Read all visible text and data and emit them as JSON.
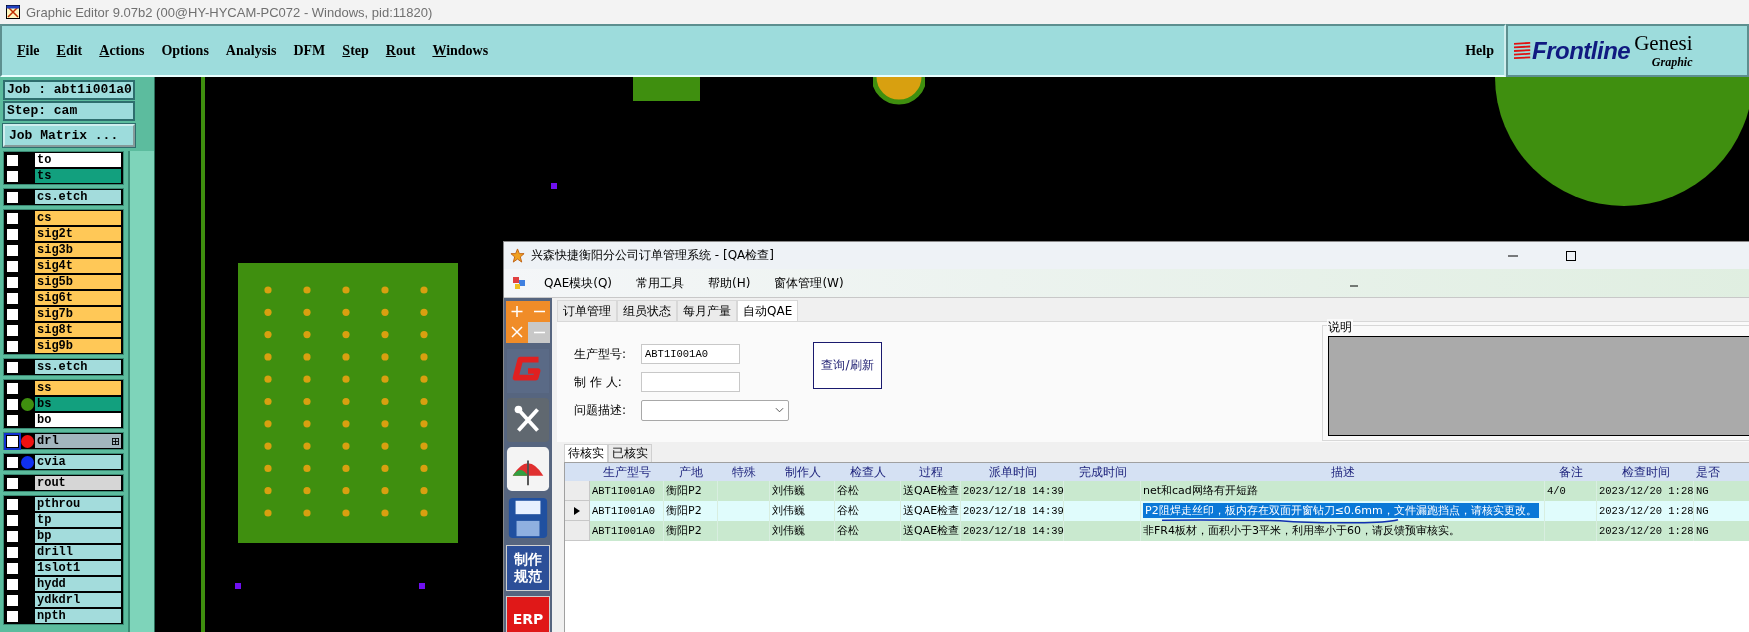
{
  "window": {
    "title": "Graphic Editor 9.07b2 (00@HY-HYCAM-PC072 - Windows, pid:11820)"
  },
  "menu_bar": {
    "items": [
      {
        "label": "File",
        "underlined": true
      },
      {
        "label": "Edit",
        "underlined": true
      },
      {
        "label": "Actions",
        "underlined": true
      },
      {
        "label": "Options",
        "underlined": false
      },
      {
        "label": "Analysis",
        "underlined": false
      },
      {
        "label": "DFM",
        "underlined": false
      },
      {
        "label": "Step",
        "underlined": true
      },
      {
        "label": "Rout",
        "underlined": true
      },
      {
        "label": "Windows",
        "underlined": true
      }
    ],
    "help": "Help"
  },
  "logo": {
    "brand": "Frontline",
    "product": "Genesi",
    "subtitle": "Graphic"
  },
  "job_panel": {
    "job": "Job : abt1i001a0",
    "step": "Step: cam",
    "matrix_button": "Job Matrix ..."
  },
  "layer_groups": [
    {
      "layers": [
        {
          "name": "to",
          "color": "#ffffff",
          "checked": false,
          "selected": false
        },
        {
          "name": "ts",
          "color": "#12a07e",
          "checked": false,
          "selected": false
        }
      ]
    },
    {
      "layers": [
        {
          "name": "cs.etch",
          "color": "#a3dcdc",
          "checked": false,
          "selected": false
        }
      ]
    },
    {
      "layers": [
        {
          "name": "cs",
          "color": "#ffc857",
          "checked": false,
          "selected": false
        },
        {
          "name": "sig2t",
          "color": "#ffc857",
          "checked": false,
          "selected": false
        },
        {
          "name": "sig3b",
          "color": "#ffc857",
          "checked": false,
          "selected": false
        },
        {
          "name": "sig4t",
          "color": "#ffc857",
          "checked": false,
          "selected": false
        },
        {
          "name": "sig5b",
          "color": "#ffc857",
          "checked": false,
          "selected": false
        },
        {
          "name": "sig6t",
          "color": "#ffc857",
          "checked": false,
          "selected": false
        },
        {
          "name": "sig7b",
          "color": "#ffc857",
          "checked": false,
          "selected": false
        },
        {
          "name": "sig8t",
          "color": "#ffc857",
          "checked": false,
          "selected": false
        },
        {
          "name": "sig9b",
          "color": "#ffc857",
          "checked": false,
          "selected": false
        }
      ]
    },
    {
      "layers": [
        {
          "name": "ss.etch",
          "color": "#a3dcdc",
          "checked": false,
          "selected": false
        }
      ]
    },
    {
      "layers": [
        {
          "name": "ss",
          "color": "#ffc857",
          "checked": false,
          "selected": false
        },
        {
          "name": "bs",
          "color": "#12a07e",
          "dot": {
            "color": "#3f8f0f"
          },
          "checked": false,
          "selected": false
        },
        {
          "name": "bo",
          "color": "#ffffff",
          "checked": false,
          "selected": false
        }
      ]
    },
    {
      "layers": [
        {
          "name": "drl",
          "color": "#a2b6be",
          "dot": {
            "color": "#f01010"
          },
          "checked": false,
          "selected": true
        }
      ]
    },
    {
      "layers": [
        {
          "name": "cvia",
          "color": "#a3dcdc",
          "dot": {
            "color": "#1030f0"
          },
          "checked": false,
          "selected": false
        }
      ]
    },
    {
      "layers": [
        {
          "name": "rout",
          "color": "#d6d6d6",
          "checked": false,
          "selected": false
        }
      ]
    },
    {
      "layers": [
        {
          "name": "pthrou",
          "color": "#a3dcdc",
          "checked": false,
          "selected": false
        },
        {
          "name": "tp",
          "color": "#a3dcdc",
          "checked": false,
          "selected": false
        },
        {
          "name": "bp",
          "color": "#a3dcdc",
          "checked": false,
          "selected": false
        },
        {
          "name": "drill",
          "color": "#a3dcdc",
          "checked": false,
          "selected": false
        },
        {
          "name": "1slot1",
          "color": "#a3dcdc",
          "checked": false,
          "selected": false
        },
        {
          "name": "hydd",
          "color": "#a3dcdc",
          "checked": false,
          "selected": false
        },
        {
          "name": "ydkdrl",
          "color": "#a3dcdc",
          "checked": false,
          "selected": false
        },
        {
          "name": "npth",
          "color": "#a3dcdc",
          "checked": false,
          "selected": false
        }
      ]
    }
  ],
  "dialog": {
    "title": "兴森快捷衡阳分公司订单管理系统 - [QA检查]",
    "menu": [
      "QAE模块(Q)",
      "常用工具",
      "帮助(H)",
      "窗体管理(W)"
    ],
    "toolbar": [
      {
        "kind": "calculator"
      },
      {
        "kind": "logo"
      },
      {
        "kind": "tools"
      },
      {
        "kind": "umbrella"
      },
      {
        "kind": "save"
      },
      {
        "kind": "text",
        "label": "制作规范",
        "color": "#2c4f98"
      },
      {
        "kind": "text",
        "label": "ERP",
        "color": "#e01818"
      }
    ],
    "tabs": [
      {
        "label": "订单管理",
        "selected": false
      },
      {
        "label": "组员状态",
        "selected": false
      },
      {
        "label": "每月产量",
        "selected": false
      },
      {
        "label": "自动QAE",
        "selected": true
      }
    ],
    "form": {
      "model_label": "生产型号:",
      "model_value": "ABT1I001A0",
      "maker_label": "制 作 人:",
      "issue_label": "问题描述:",
      "query_button": "查询/刷新"
    },
    "note_group": {
      "label": "说明"
    },
    "subtabs": [
      {
        "label": "待核实",
        "selected": true
      },
      {
        "label": "已核实",
        "selected": false
      }
    ],
    "table": {
      "columns": [
        "生产型号",
        "产地",
        "特殊",
        "制作人",
        "检查人",
        "过程",
        "派单时间",
        "完成时间",
        "描述",
        "备注",
        "检查时间",
        "是否"
      ],
      "rows": [
        {
          "model": "ABT1I001A0",
          "origin": "衡阳P2",
          "maker": "刘伟巍",
          "inspector": "谷松",
          "process": "送QAE检查",
          "dispatch_time": "2023/12/18 14:39",
          "description": "net和cad网络有开短路",
          "remark": "4/0",
          "check_time": "2023/12/20 1:28",
          "result": "NG",
          "selected": false
        },
        {
          "model": "ABT1I001A0",
          "origin": "衡阳P2",
          "maker": "刘伟巍",
          "inspector": "谷松",
          "process": "送QAE检查",
          "dispatch_time": "2023/12/18 14:39",
          "description": "P2阻焊走丝印，板内存在双面开窗钻刀≤0.6mm，文件漏跑挡点，请核实更改。",
          "check_time": "2023/12/20 1:28",
          "result": "NG",
          "selected": true
        },
        {
          "model": "ABT1I001A0",
          "origin": "衡阳P2",
          "maker": "刘伟巍",
          "inspector": "谷松",
          "process": "送QAE检查",
          "dispatch_time": "2023/12/18 14:39",
          "description": "非FR4板材，面积小于3平米，利用率小于60，请反馈预审核实。",
          "check_time": "2023/12/20 1:28",
          "result": "NG",
          "selected": false
        }
      ]
    }
  }
}
